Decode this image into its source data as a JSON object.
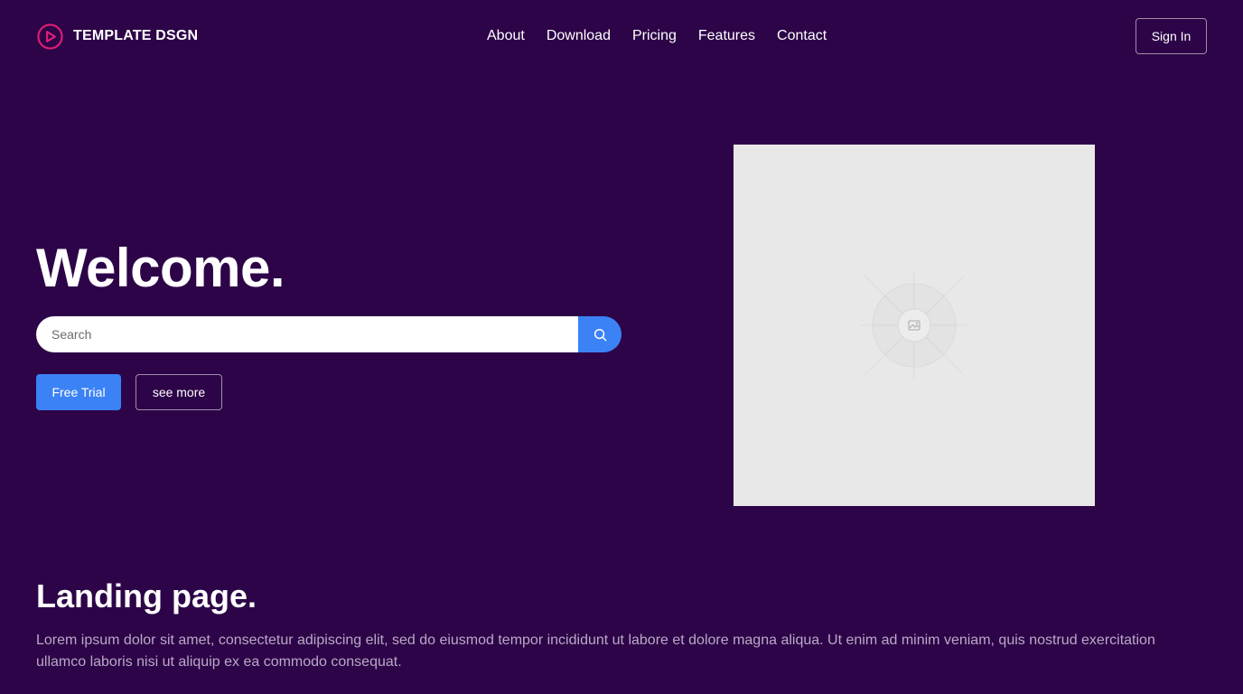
{
  "colors": {
    "background": "#2d0448",
    "accent": "#3b82f6",
    "logo": "#e11d74",
    "placeholder_bg": "#e8e8e8",
    "muted_text": "#b9a9c7"
  },
  "header": {
    "brand": {
      "logo_icon": "play-circle-icon",
      "name": "TEMPLATE DSGN"
    },
    "nav": [
      "About",
      "Download",
      "Pricing",
      "Features",
      "Contact"
    ],
    "sign_in_label": "Sign In"
  },
  "hero": {
    "title": "Welcome.",
    "search": {
      "placeholder": "Search",
      "value": "",
      "button_icon": "search-icon"
    },
    "primary_button_label": "Free Trial",
    "secondary_button_label": "see more",
    "image_icon": "image-placeholder-icon"
  },
  "section": {
    "title": "Landing page.",
    "body": "Lorem ipsum dolor sit amet, consectetur adipiscing elit, sed do eiusmod tempor incididunt ut labore et dolore magna aliqua. Ut enim ad minim veniam, quis nostrud exercitation ullamco laboris nisi ut aliquip ex ea commodo consequat."
  }
}
